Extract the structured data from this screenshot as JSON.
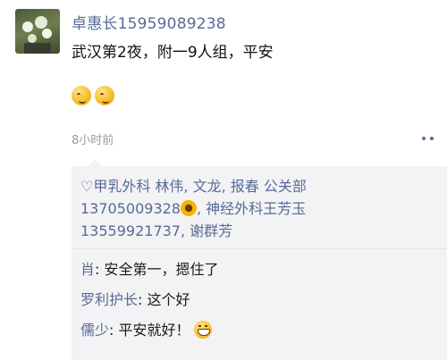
{
  "post": {
    "author": "卓惠长15959089238",
    "text": "武汉第2夜，附一9人组，平安",
    "emojis": [
      "smiling-emoji",
      "smiling-emoji"
    ],
    "time": "8小时前"
  },
  "likes": {
    "part1": "甲乳外科 林伟, 文龙, 报春 公关部 13705009328",
    "part2": ", 神经外科王芳玉 13559921737, 谢群芳"
  },
  "comments": [
    {
      "author": "肖",
      "text": ": 安全第一，摁住了"
    },
    {
      "author": "罗利护长",
      "text": ": 这个好"
    },
    {
      "author": "儒少",
      "text": ": 平安就好！"
    }
  ],
  "colors": {
    "link": "#576b95",
    "comment_bg": "#f3f3f5"
  },
  "icons": [
    "heart-icon",
    "sunflower-emoji",
    "more-dots-icon",
    "grin-emoji"
  ]
}
